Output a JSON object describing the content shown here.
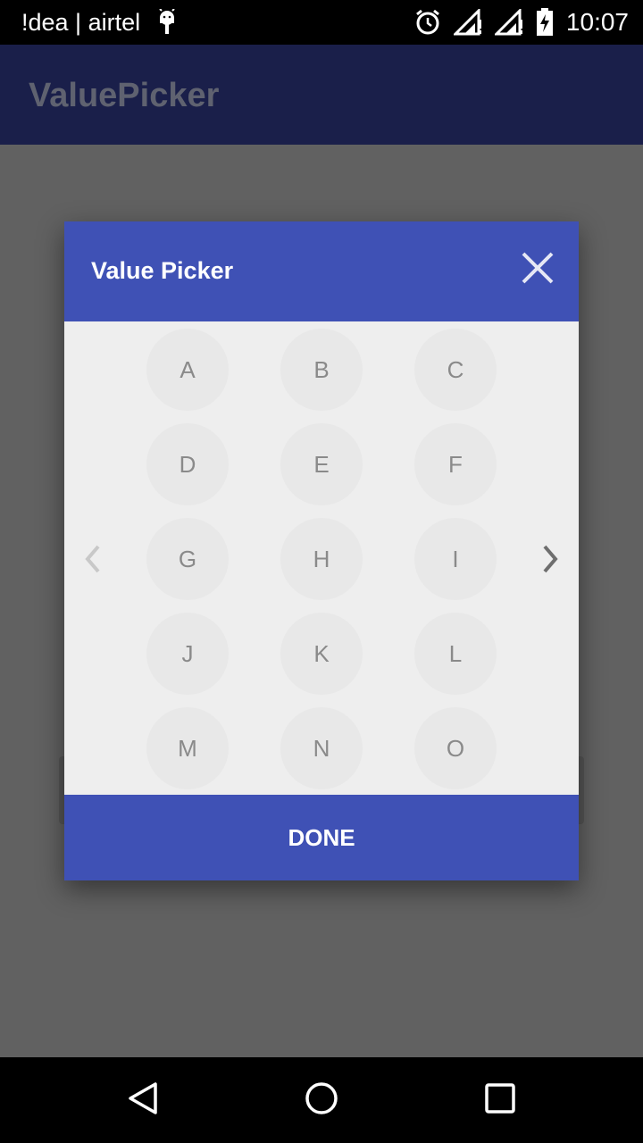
{
  "status_bar": {
    "carrier": "!dea | airtel",
    "time": "10:07",
    "icons": [
      "android-debug-icon",
      "alarm-icon",
      "signal-icon",
      "signal-icon",
      "battery-charging-icon"
    ]
  },
  "app_bar": {
    "title": "ValuePicker"
  },
  "dialog": {
    "title": "Value Picker",
    "close_icon": "close-icon",
    "values": [
      "A",
      "B",
      "C",
      "D",
      "E",
      "F",
      "G",
      "H",
      "I",
      "J",
      "K",
      "L",
      "M",
      "N",
      "O"
    ],
    "prev_icon": "chevron-left-icon",
    "next_icon": "chevron-right-icon",
    "done_label": "DONE"
  },
  "nav_bar": {
    "buttons": [
      "back-icon",
      "home-icon",
      "recents-icon"
    ]
  },
  "colors": {
    "primary": "#3f51b5",
    "app_bar_dimmed": "#1a1f4a",
    "scrim_background": "#616161",
    "dialog_background": "#eeeeee"
  }
}
